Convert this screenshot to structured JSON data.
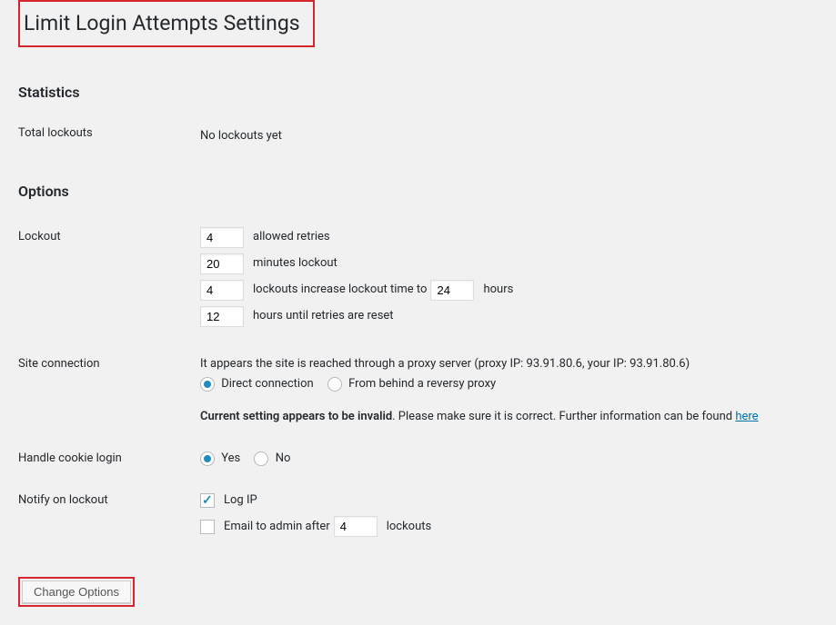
{
  "page_title": "Limit Login Attempts Settings",
  "statistics": {
    "heading": "Statistics",
    "total_lockouts_label": "Total lockouts",
    "total_lockouts_value": "No lockouts yet"
  },
  "options": {
    "heading": "Options",
    "lockout": {
      "label": "Lockout",
      "allowed_retries_value": "4",
      "allowed_retries_text": "allowed retries",
      "minutes_lockout_value": "20",
      "minutes_lockout_text": "minutes lockout",
      "lockouts_increase_value": "4",
      "lockouts_increase_text_before": "lockouts increase lockout time to",
      "lockouts_increase_hours_value": "24",
      "lockouts_increase_text_after": "hours",
      "hours_reset_value": "12",
      "hours_reset_text": "hours until retries are reset"
    },
    "site_connection": {
      "label": "Site connection",
      "proxy_info": "It appears the site is reached through a proxy server (proxy IP: 93.91.80.6, your IP: 93.91.80.6)",
      "direct_label": "Direct connection",
      "proxy_label": "From behind a reversy proxy",
      "warning_bold": "Current setting appears to be invalid",
      "warning_text": ". Please make sure it is correct. Further information can be found ",
      "warning_link": "here"
    },
    "handle_cookie": {
      "label": "Handle cookie login",
      "yes_label": "Yes",
      "no_label": "No"
    },
    "notify": {
      "label": "Notify on lockout",
      "log_ip_label": "Log IP",
      "email_before": "Email to admin after",
      "email_value": "4",
      "email_after": "lockouts"
    }
  },
  "submit_label": "Change Options"
}
